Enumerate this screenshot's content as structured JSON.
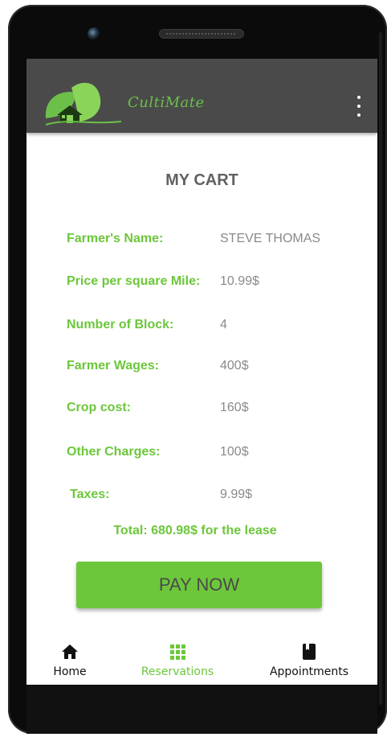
{
  "app": {
    "brand": "CultiMate"
  },
  "cart": {
    "title": "MY CART",
    "rows": [
      {
        "label": "Farmer's Name:",
        "value": "STEVE THOMAS"
      },
      {
        "label": "Price per square Mile:",
        "value": "10.99$"
      },
      {
        "label": "Number of Block:",
        "value": "4"
      },
      {
        "label": "Farmer Wages:",
        "value": "400$"
      },
      {
        "label": "Crop cost:",
        "value": "160$"
      },
      {
        "label": "Other Charges:",
        "value": "100$"
      },
      {
        "label": "Taxes:",
        "value": "9.99$"
      }
    ],
    "total": "Total: 680.98$ for the lease",
    "pay_label": "PAY NOW"
  },
  "nav": {
    "items": [
      {
        "label": "Home",
        "icon": "home-icon",
        "active": false
      },
      {
        "label": "Reservations",
        "icon": "grid-icon",
        "active": true
      },
      {
        "label": "Appointments",
        "icon": "book-icon",
        "active": false
      }
    ]
  },
  "colors": {
    "accent": "#6cc73a",
    "appbar": "#4a4a4a",
    "value_text": "#8a8a8a",
    "title_text": "#616161"
  }
}
